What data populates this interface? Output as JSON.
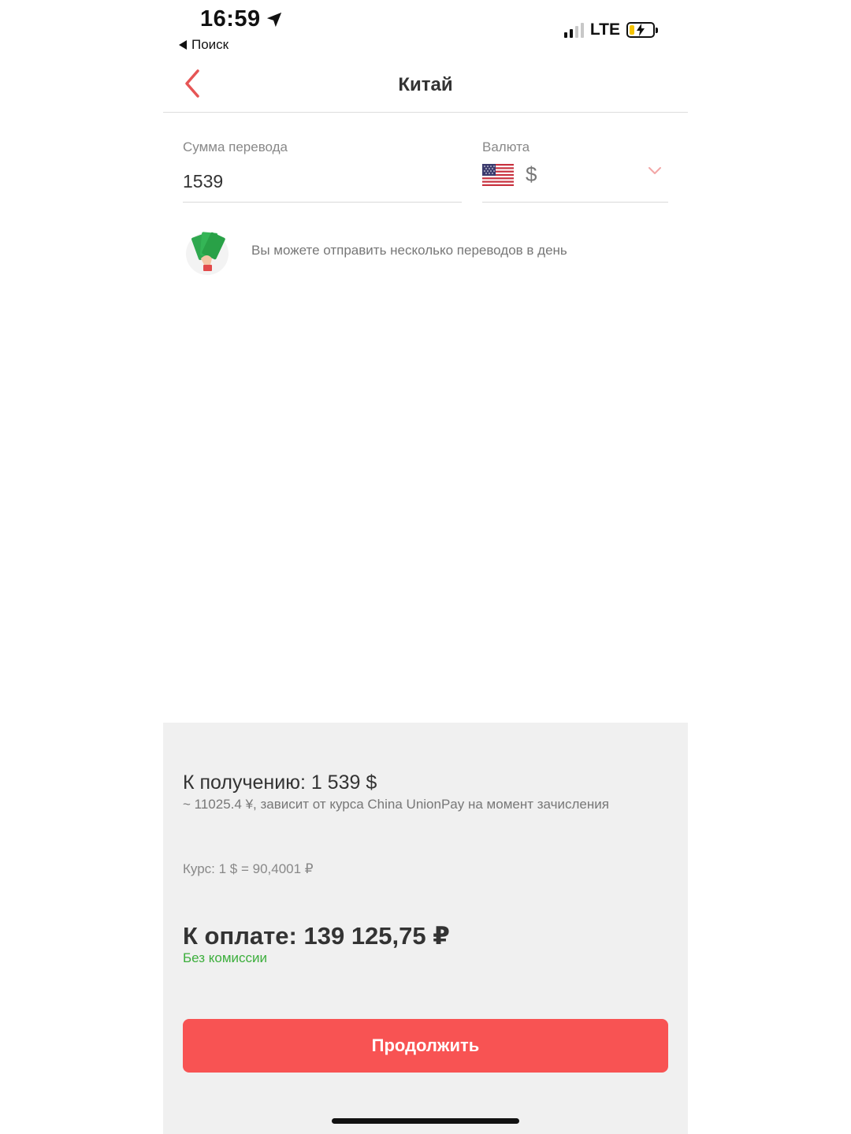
{
  "status_bar": {
    "time": "16:59",
    "back_app": "Поиск",
    "network": "LTE"
  },
  "nav": {
    "title": "Китай"
  },
  "form": {
    "amount_label": "Сумма перевода",
    "amount_value": "1539",
    "currency_label": "Валюта",
    "currency_symbol": "$",
    "currency_flag": "us-flag-icon"
  },
  "notice": {
    "text": "Вы можете отправить несколько переводов в день",
    "icon": "money-hand-icon"
  },
  "summary": {
    "receive": "К получению: 1 539 $",
    "receive_note": "~ 11025.4 ¥, зависит от курса China UnionPay на момент зачисления",
    "rate": "Курс: 1 $ = 90,4001 ₽",
    "pay": "К оплате: 139 125,75 ₽",
    "fee_note": "Без комиссии"
  },
  "actions": {
    "continue_label": "Продолжить"
  },
  "colors": {
    "accent": "#f85353",
    "fee_green": "#3cae3c",
    "panel_bg": "#f0f0f0"
  }
}
